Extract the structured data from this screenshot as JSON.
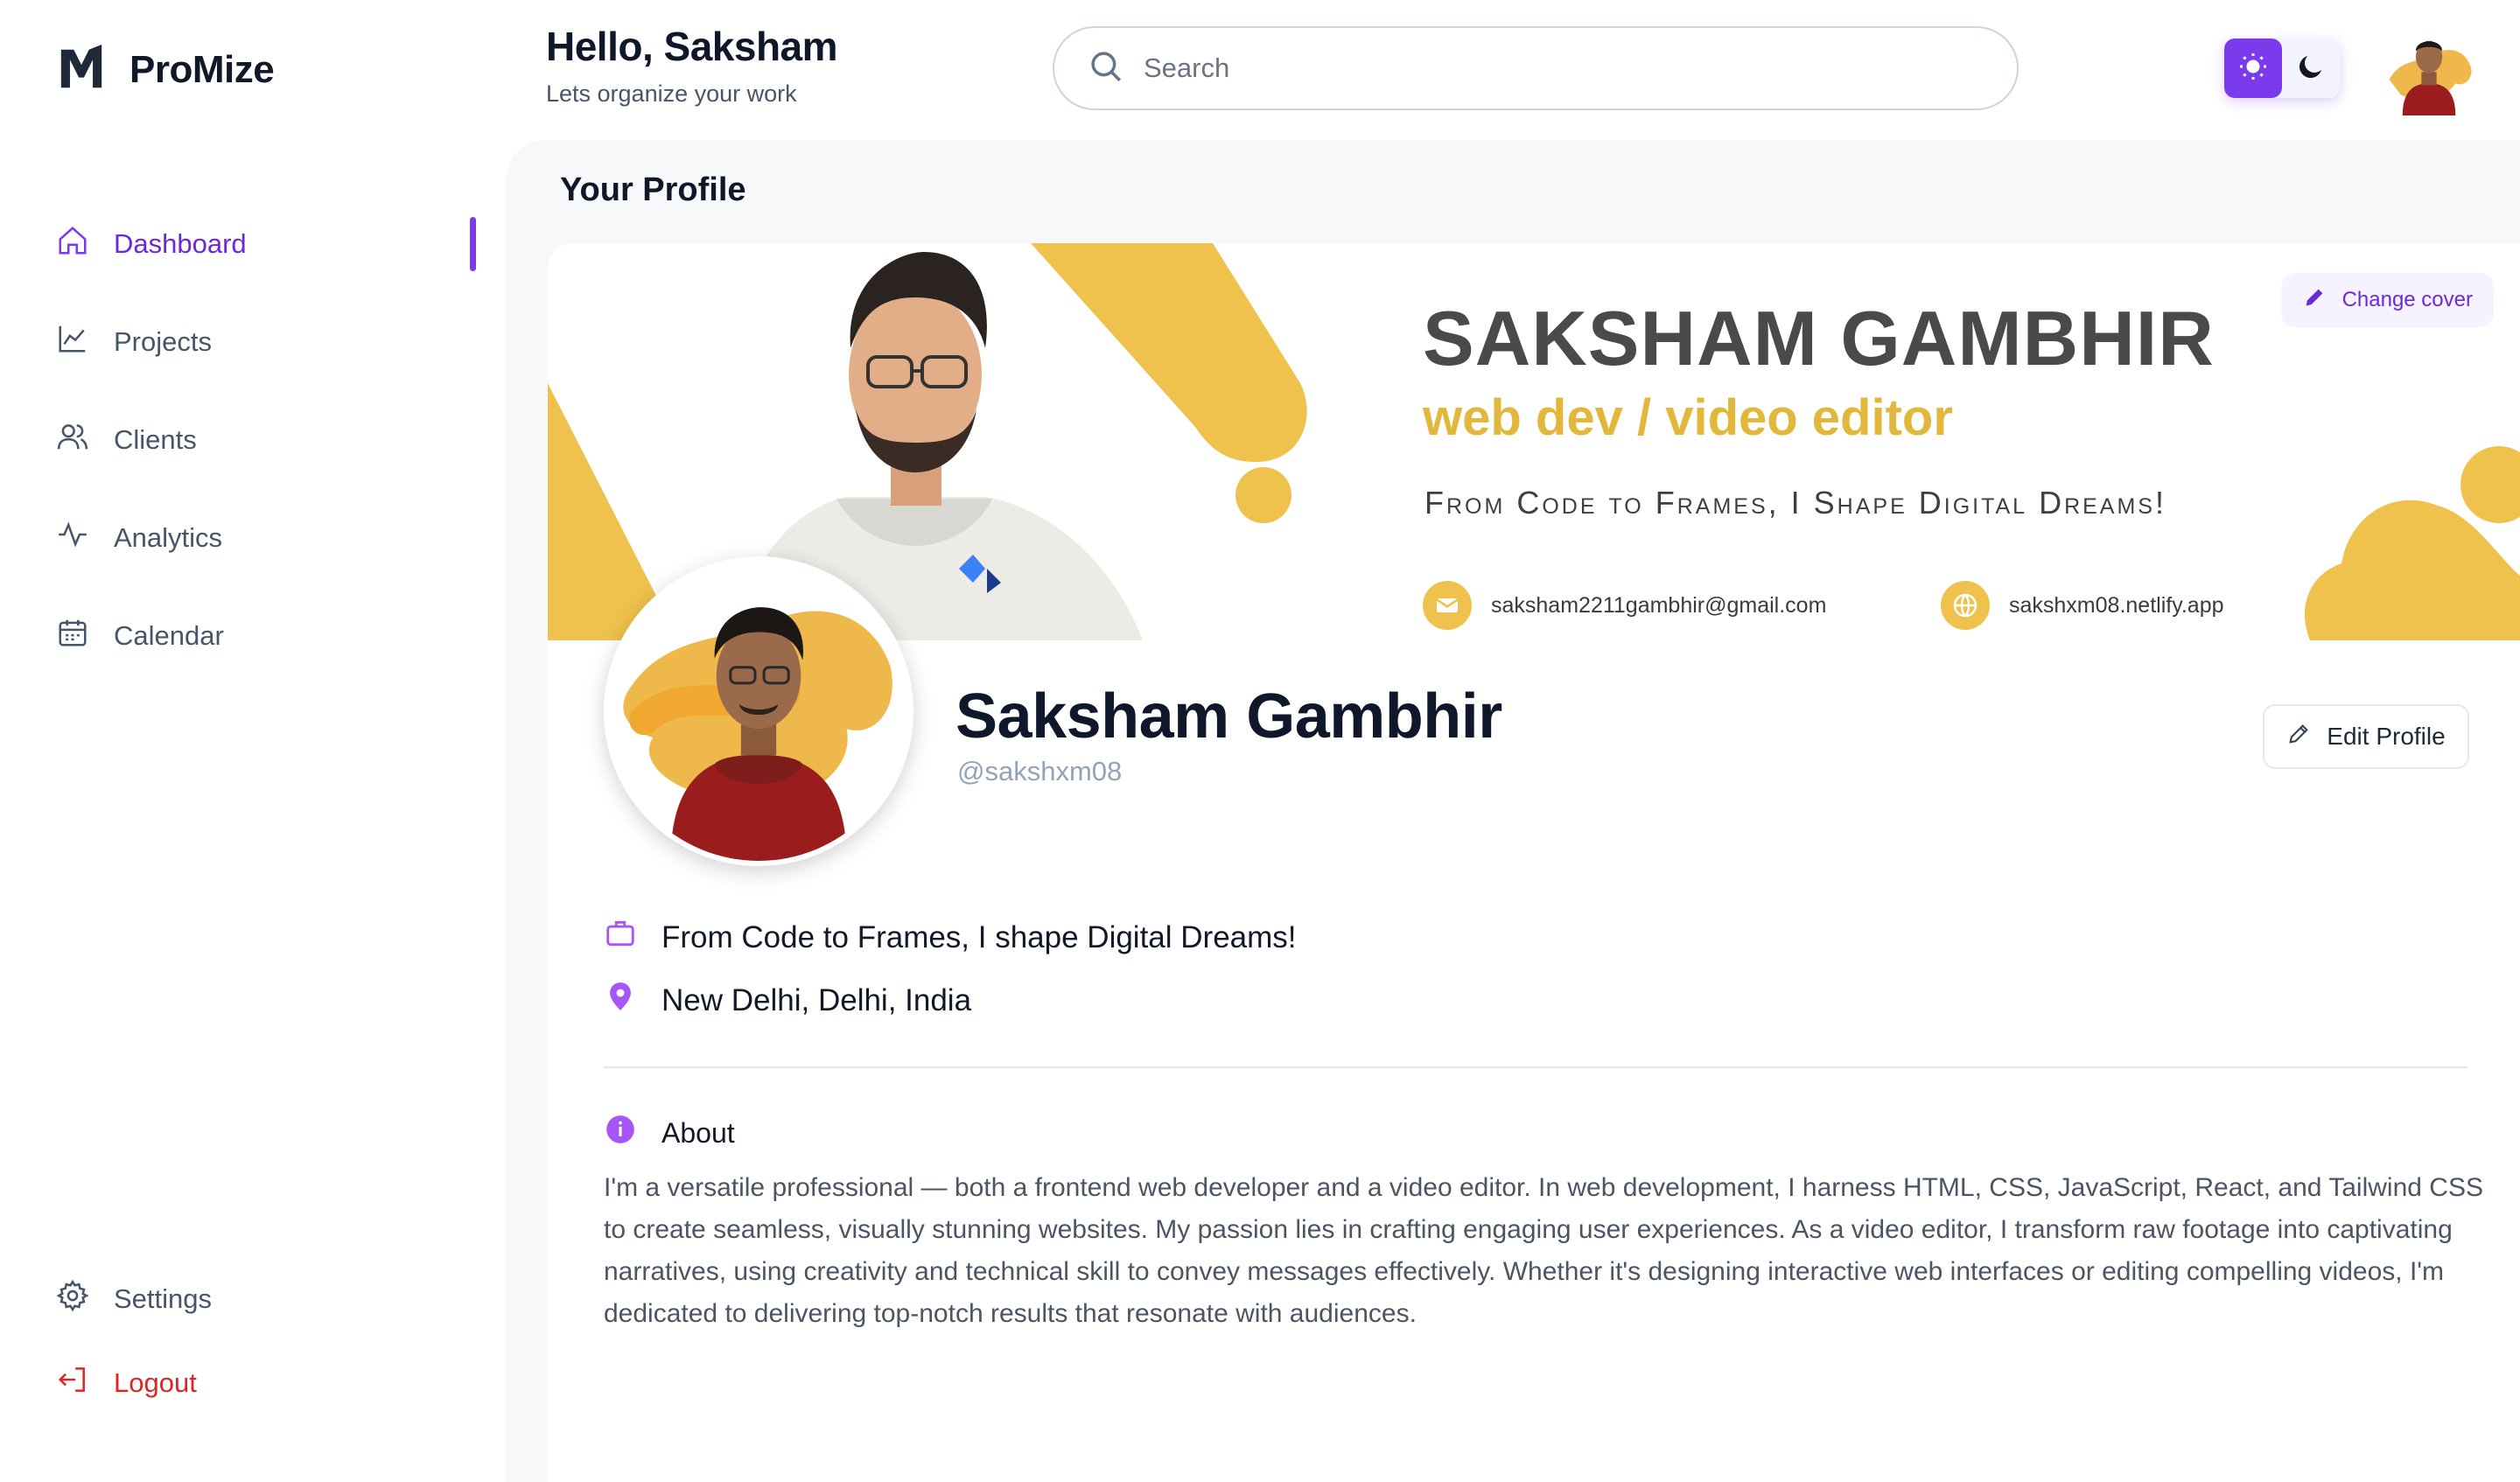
{
  "brand": {
    "name": "ProMize"
  },
  "sidebar": {
    "items": [
      {
        "label": "Dashboard",
        "icon": "home-icon",
        "active": true
      },
      {
        "label": "Projects",
        "icon": "chart-line-icon"
      },
      {
        "label": "Clients",
        "icon": "users-icon"
      },
      {
        "label": "Analytics",
        "icon": "activity-icon"
      },
      {
        "label": "Calendar",
        "icon": "calendar-icon"
      }
    ],
    "bottom": [
      {
        "label": "Settings",
        "icon": "gear-icon"
      },
      {
        "label": "Logout",
        "icon": "logout-icon"
      }
    ]
  },
  "header": {
    "greeting": "Hello, Saksham",
    "subtitle": "Lets organize your work",
    "search_placeholder": "Search",
    "theme": {
      "light_icon": "sun-icon",
      "dark_icon": "moon-icon",
      "selected": "light"
    }
  },
  "profile": {
    "section_title": "Your Profile",
    "cover": {
      "name": "SAKSHAM GAMBHIR",
      "role": "web dev / video editor",
      "tagline": "From Code to Frames, I Shape Digital Dreams!",
      "email": "saksham2211gambhir@gmail.com",
      "website": "sakshxm08.netlify.app",
      "change_cover_label": "Change cover"
    },
    "name": "Saksham Gambhir",
    "handle": "@sakshxm08",
    "edit_label": "Edit Profile",
    "headline": "From Code to Frames, I shape Digital Dreams!",
    "location": "New Delhi, Delhi, India",
    "about_label": "About",
    "about_text": "I'm a versatile professional — both a frontend web developer and a video editor. In web development, I harness HTML, CSS, JavaScript, React, and Tailwind CSS to create seamless, visually stunning websites. My passion lies in crafting engaging user experiences. As a video editor, I transform raw footage into captivating narratives, using creativity and technical skill to convey messages effectively. Whether it's designing interactive web interfaces or editing compelling videos, I'm dedicated to delivering top-notch results that resonate with audiences."
  },
  "colors": {
    "accent": "#7c3aed",
    "cover_yellow": "#efc24e",
    "logout": "#dc2626"
  }
}
